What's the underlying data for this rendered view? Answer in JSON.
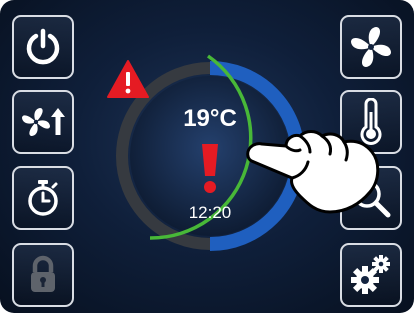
{
  "status": {
    "temperature": "19°C",
    "time": "12:20"
  },
  "left_buttons": [
    {
      "icon": "power-icon"
    },
    {
      "icon": "fan-boost-icon"
    },
    {
      "icon": "timer-icon"
    },
    {
      "icon": "lock-icon",
      "state": "disabled"
    }
  ],
  "right_buttons": [
    {
      "icon": "fan-icon"
    },
    {
      "icon": "thermometer-icon"
    },
    {
      "icon": "search-icon"
    },
    {
      "icon": "settings-gears-icon"
    }
  ],
  "dial": {
    "warning_icon": "warning-triangle-icon",
    "alert_icon": "exclamation-icon"
  },
  "colors": {
    "alert_red": "#e51b23",
    "ring_green": "#48b838",
    "ring_blue": "#1f5fbf",
    "ring_gray": "#3a3a3a"
  }
}
